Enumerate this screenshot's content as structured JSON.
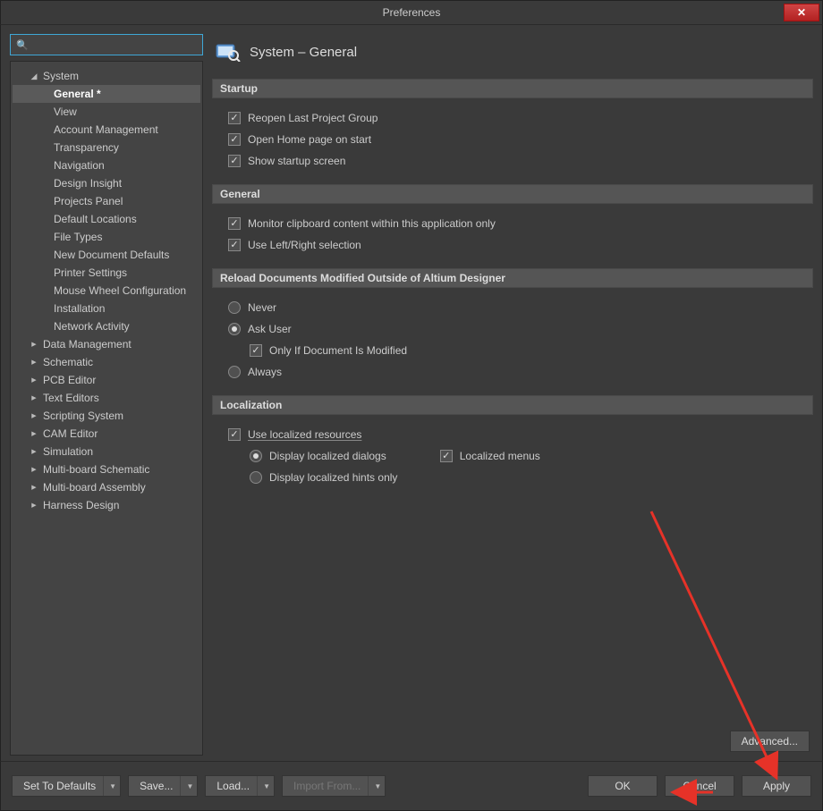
{
  "window": {
    "title": "Preferences"
  },
  "search": {
    "placeholder": ""
  },
  "tree": {
    "nodes": [
      {
        "label": "System",
        "expanded": true,
        "children": [
          "General *",
          "View",
          "Account Management",
          "Transparency",
          "Navigation",
          "Design Insight",
          "Projects Panel",
          "Default Locations",
          "File Types",
          "New Document Defaults",
          "Printer Settings",
          "Mouse Wheel Configuration",
          "Installation",
          "Network Activity"
        ],
        "selected": "General *"
      },
      {
        "label": "Data Management",
        "expanded": false
      },
      {
        "label": "Schematic",
        "expanded": false
      },
      {
        "label": "PCB Editor",
        "expanded": false
      },
      {
        "label": "Text Editors",
        "expanded": false
      },
      {
        "label": "Scripting System",
        "expanded": false
      },
      {
        "label": "CAM Editor",
        "expanded": false
      },
      {
        "label": "Simulation",
        "expanded": false
      },
      {
        "label": "Multi-board Schematic",
        "expanded": false
      },
      {
        "label": "Multi-board Assembly",
        "expanded": false
      },
      {
        "label": "Harness Design",
        "expanded": false
      }
    ]
  },
  "page": {
    "title": "System – General",
    "sections": {
      "startup": {
        "title": "Startup",
        "reopen_last": {
          "label": "Reopen Last Project Group",
          "checked": true
        },
        "open_home": {
          "label": "Open Home page on start",
          "checked": true
        },
        "show_splash": {
          "label": "Show startup screen",
          "checked": true
        }
      },
      "general": {
        "title": "General",
        "monitor_clipboard": {
          "label": "Monitor clipboard content within this application only",
          "checked": true
        },
        "use_lr_selection": {
          "label": "Use Left/Right selection",
          "checked": true
        }
      },
      "reload": {
        "title": "Reload Documents Modified Outside of Altium Designer",
        "never": {
          "label": "Never",
          "selected": false
        },
        "ask": {
          "label": "Ask User",
          "selected": true
        },
        "only_if_modified": {
          "label": "Only If Document Is Modified",
          "checked": true
        },
        "always": {
          "label": "Always",
          "selected": false
        }
      },
      "localization": {
        "title": "Localization",
        "use_localized": {
          "label": "Use localized resources",
          "checked": true
        },
        "display_dialogs": {
          "label": "Display localized dialogs",
          "selected": true
        },
        "localized_menus": {
          "label": "Localized menus",
          "checked": true
        },
        "display_hints": {
          "label": "Display localized hints only",
          "selected": false
        }
      }
    },
    "advanced_label": "Advanced..."
  },
  "footer": {
    "set_defaults": "Set To Defaults",
    "save": "Save...",
    "load": "Load...",
    "import_from": "Import From...",
    "ok": "OK",
    "cancel": "Cancel",
    "apply": "Apply"
  }
}
